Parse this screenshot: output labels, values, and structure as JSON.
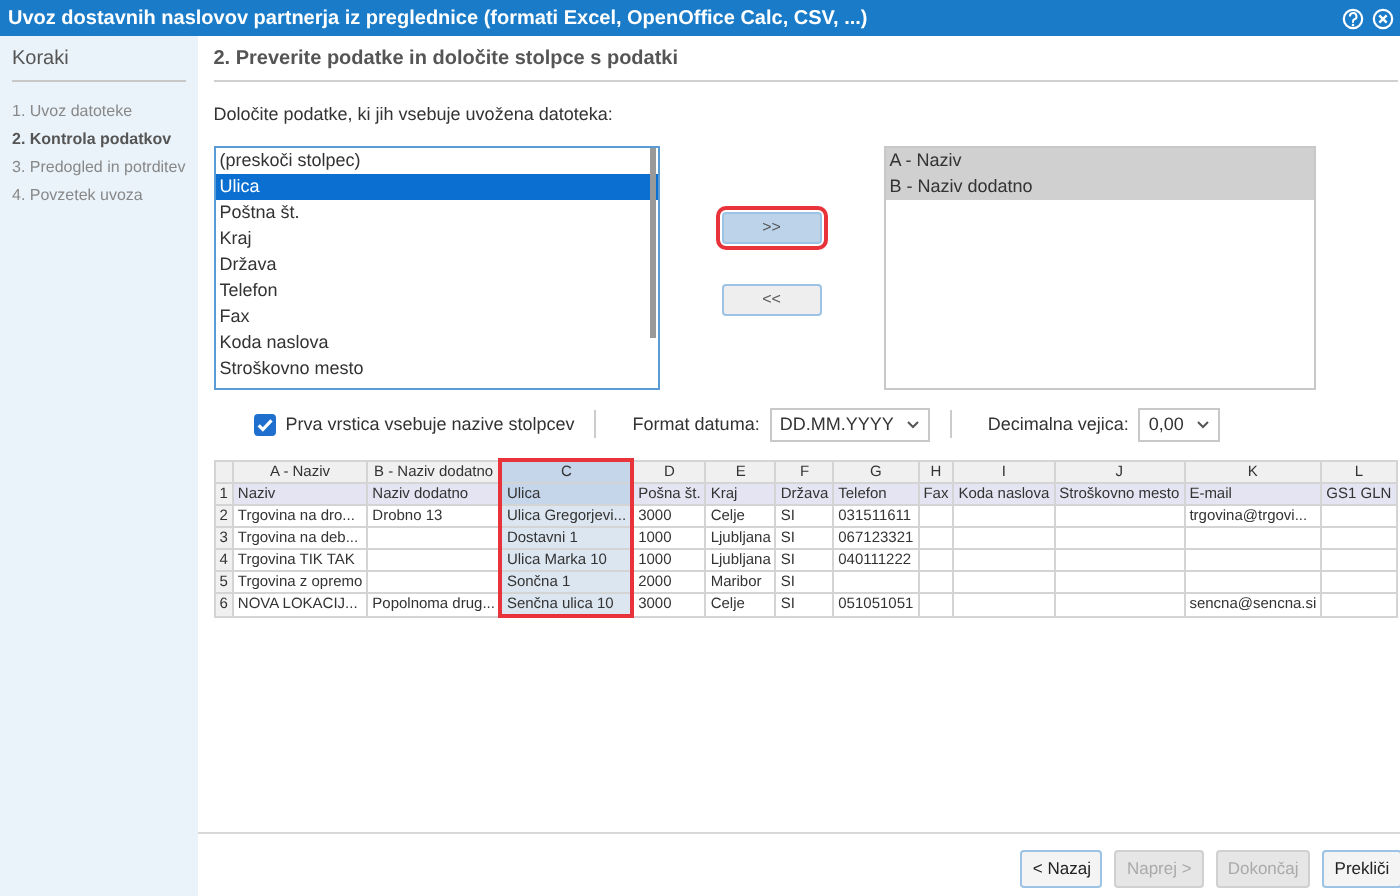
{
  "window": {
    "title": "Uvoz dostavnih naslovov partnerja iz preglednice (formati Excel, OpenOffice Calc, CSV, ...)"
  },
  "sidebar": {
    "title": "Koraki",
    "items": [
      {
        "label": "1. Uvoz datoteke",
        "selected": false
      },
      {
        "label": "2. Kontrola podatkov",
        "selected": true
      },
      {
        "label": "3. Predogled in potrditev",
        "selected": false
      },
      {
        "label": "4. Povzetek uvoza",
        "selected": false
      }
    ]
  },
  "main": {
    "heading": "2. Preverite podatke in določite stolpce s podatki",
    "instruction": "Določite podatke, ki jih vsebuje uvožena datoteka:"
  },
  "available_fields": [
    {
      "label": "(preskoči stolpec)",
      "selected": false
    },
    {
      "label": "Ulica",
      "selected": true
    },
    {
      "label": "Poštna št.",
      "selected": false
    },
    {
      "label": "Kraj",
      "selected": false
    },
    {
      "label": "Država",
      "selected": false
    },
    {
      "label": "Telefon",
      "selected": false
    },
    {
      "label": "Fax",
      "selected": false
    },
    {
      "label": "Koda naslova",
      "selected": false
    },
    {
      "label": "Stroškovno mesto",
      "selected": false
    }
  ],
  "move_buttons": [
    {
      "label": ">>",
      "highlighted": true
    },
    {
      "label": "<<",
      "highlighted": false
    }
  ],
  "assigned_fields": [
    {
      "label": "A - Naziv",
      "selected": true
    },
    {
      "label": "B - Naziv dodatno",
      "selected": true
    }
  ],
  "options": {
    "header_row": {
      "label": "Prva vrstica vsebuje nazive stolpcev",
      "checked": true
    },
    "date_format": {
      "label": "Format datuma:",
      "value": "DD.MM.YYYY"
    },
    "decimal_separator": {
      "label": "Decimalna vejica:",
      "value": "0,00"
    }
  },
  "table": {
    "columns": [
      {
        "label": "A - Naziv",
        "selected": false,
        "highlighted": false
      },
      {
        "label": "B - Naziv dodatno",
        "selected": false,
        "highlighted": false
      },
      {
        "label": "C",
        "selected": true,
        "highlighted": true
      },
      {
        "label": "D",
        "selected": false,
        "highlighted": false
      },
      {
        "label": "E",
        "selected": false,
        "highlighted": false
      },
      {
        "label": "F",
        "selected": false,
        "highlighted": false
      },
      {
        "label": "G",
        "selected": false,
        "highlighted": false
      },
      {
        "label": "H",
        "selected": false,
        "highlighted": false
      },
      {
        "label": "I",
        "selected": false,
        "highlighted": false
      },
      {
        "label": "J",
        "selected": false,
        "highlighted": false
      },
      {
        "label": "K",
        "selected": false,
        "highlighted": false
      },
      {
        "label": "L",
        "selected": false,
        "highlighted": false
      }
    ],
    "rows": [
      {
        "number": "1",
        "header": true,
        "cells": [
          "Naziv",
          "Naziv dodatno",
          "Ulica",
          "Pošna št.",
          "Kraj",
          "Država",
          "Telefon",
          "Fax",
          "Koda naslova",
          "Stroškovno mesto",
          "E-mail",
          "GS1 GLN"
        ]
      },
      {
        "number": "2",
        "header": false,
        "cells": [
          "Trgovina na dro...",
          "Drobno 13",
          "Ulica Gregorjevi...",
          "3000",
          "Celje",
          "SI",
          "031511611",
          "",
          "",
          "",
          "trgovina@trgovi...",
          ""
        ]
      },
      {
        "number": "3",
        "header": false,
        "cells": [
          "Trgovina na deb...",
          "",
          "Dostavni 1",
          "1000",
          "Ljubljana",
          "SI",
          "067123321",
          "",
          "",
          "",
          "",
          ""
        ]
      },
      {
        "number": "4",
        "header": false,
        "cells": [
          "Trgovina TIK TAK",
          "",
          "Ulica Marka 10",
          "1000",
          "Ljubljana",
          "SI",
          "040111222",
          "",
          "",
          "",
          "",
          ""
        ]
      },
      {
        "number": "5",
        "header": false,
        "cells": [
          "Trgovina z opremo",
          "",
          "Sončna 1",
          "2000",
          "Maribor",
          "SI",
          "",
          "",
          "",
          "",
          "",
          ""
        ]
      },
      {
        "number": "6",
        "header": false,
        "cells": [
          "NOVA LOKACIJ...",
          "Popolnoma drug...",
          "Senčna ulica 10",
          "3000",
          "Celje",
          "SI",
          "051051051",
          "",
          "",
          "",
          "sencna@sencna.si",
          ""
        ]
      }
    ]
  },
  "footer_buttons": [
    {
      "label": "< Nazaj",
      "disabled": false
    },
    {
      "label": "Naprej >",
      "disabled": true
    },
    {
      "label": "Dokončaj",
      "disabled": true
    },
    {
      "label": "Prekliči",
      "disabled": false
    }
  ]
}
